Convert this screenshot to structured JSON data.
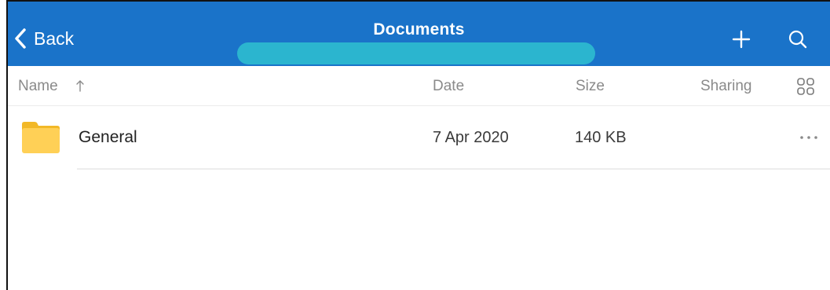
{
  "header": {
    "back_label": "Back",
    "title": "Documents",
    "accent_color": "#1a73c9",
    "icons": {
      "back": "chevron-left-icon",
      "add": "plus-icon",
      "search": "search-icon"
    }
  },
  "columns": {
    "name": "Name",
    "date": "Date",
    "size": "Size",
    "sharing": "Sharing",
    "sort_icon": "arrow-up-icon",
    "view_icon": "grid-view-icon"
  },
  "files": [
    {
      "icon": "folder-icon",
      "name": "General",
      "date": "7 Apr 2020",
      "size": "140 KB",
      "more_icon": "more-horizontal-icon"
    }
  ]
}
